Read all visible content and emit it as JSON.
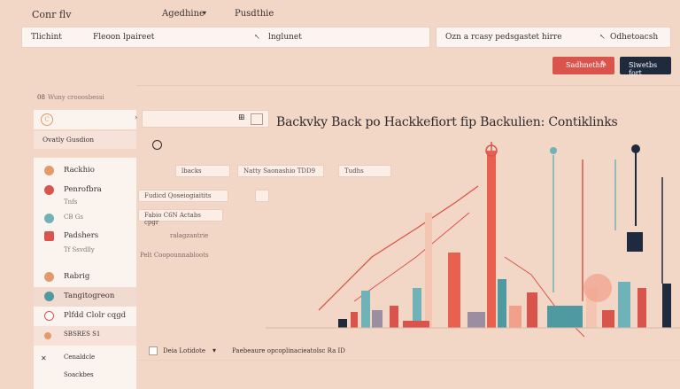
{
  "nav": {
    "brand": "Conr flv",
    "link1": "Agedhine",
    "link2": "Pusdthie"
  },
  "search1": {
    "label": "Tlichint",
    "value": "Fleoon lpaireet",
    "action": "lnglunet"
  },
  "search2": {
    "value": "Ozn a rcasy pedsgastet hirre",
    "action": "Odhetoacsh"
  },
  "buttons": {
    "primary": "Sadhnethn",
    "secondary": "Siwetbs fort"
  },
  "left_panel": {
    "header": "Wuny crooosbessi",
    "number": "08",
    "row1_letter": "C",
    "row2_label": "Ovatly Gusdion"
  },
  "heading": "Backvky Back po  Hackkefiort fip Backulien: Contiklinks",
  "chips": {
    "c1": "lbacks",
    "c2": "Natty Saonashio TDD9",
    "c3": "Tudhs",
    "c4": "Fudicd Qoseiogiaitits",
    "c5": "Fabio C6N Actabs cpgr",
    "c6": "ralagzantrie",
    "c7": "Pelt Coopounnabloots"
  },
  "sidebar": {
    "items": [
      {
        "label": "Rackhio",
        "color": "#e29a6a"
      },
      {
        "label": "Penrofbra",
        "color": "#d9544d"
      },
      {
        "label": "Tnfs",
        "color": "#e8c7b8"
      },
      {
        "label": "CB Gs",
        "color": "#6fb3b8"
      },
      {
        "label": "Padshers",
        "color": "#d9544d"
      },
      {
        "label": "Tf Ssvdlly",
        "color": "#e8c7b8"
      },
      {
        "label": "Rabrig",
        "color": "#e29a6a"
      },
      {
        "label": "Tangitogreon",
        "color": "#4e9aa0"
      },
      {
        "label": "Plfdd Clolr cqgd",
        "color": "#d9544d"
      },
      {
        "label": "SBSRES S1",
        "color": "#e29a6a"
      },
      {
        "label": "Cenaldcle",
        "color": "#1f2a3d"
      },
      {
        "label": "Soackbes",
        "color": "#1f2a3d"
      }
    ]
  },
  "footer": {
    "left": "Deia Lotidote",
    "mid": "Paebeaure opcoplinacieatolsc Ra ID"
  },
  "colors": {
    "background": "#f2d6c6",
    "red": "#d9544d",
    "navy": "#1f2a3d",
    "teal": "#6fb3b8",
    "salmon": "#e8a08a"
  },
  "icons": [
    "chevron-down-icon",
    "cursor-icon",
    "pencil-icon",
    "grid-icon",
    "close-icon",
    "chart-icon"
  ]
}
